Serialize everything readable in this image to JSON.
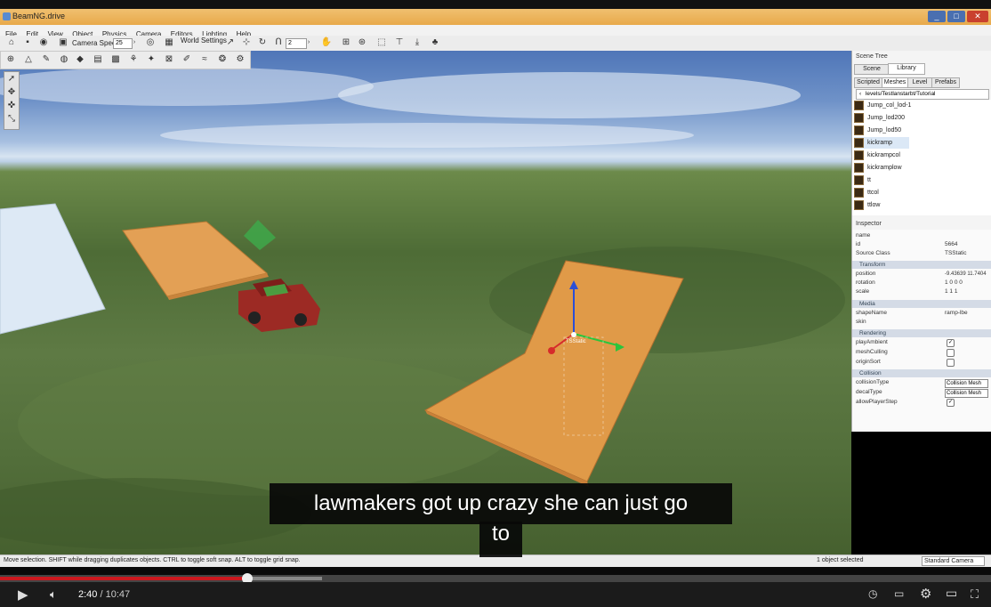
{
  "window": {
    "title": "BeamNG.drive"
  },
  "menu": [
    "File",
    "Edit",
    "View",
    "Object",
    "Physics",
    "Camera",
    "Editors",
    "Lighting",
    "Help"
  ],
  "toolbar": {
    "camera_speed_label": "Camera Speed",
    "camera_speed_value": "25",
    "world_settings_label": "World Settings",
    "grid_value": "2"
  },
  "scene_tree": {
    "header": "Scene Tree",
    "tabs": [
      "Scene",
      "Library"
    ],
    "active_tab": "Library",
    "subtabs": [
      "Scripted",
      "Meshes",
      "Level",
      "Prefabs"
    ],
    "active_subtab": "Meshes",
    "path": "levels/Testlanstarbt/Tutorial",
    "items": [
      "Jump_col_lod-1",
      "Jump_lod200",
      "Jump_lod50",
      "kickramp",
      "kickrampcol",
      "kickramplow",
      "tt",
      "ttcol",
      "ttlow"
    ],
    "selected_item": "kickramp"
  },
  "inspector": {
    "header": "Inspector",
    "rows": [
      {
        "label": "name",
        "value": ""
      },
      {
        "label": "id",
        "value": "5664"
      },
      {
        "label": "Source Class",
        "value": "TSStatic"
      }
    ],
    "transform": {
      "title": "Transform",
      "rows": [
        {
          "label": "position",
          "value": "-9.43639 11.7404"
        },
        {
          "label": "rotation",
          "value": "1 0 0 0"
        },
        {
          "label": "scale",
          "value": "1 1 1"
        }
      ]
    },
    "media": {
      "title": "Media",
      "rows": [
        {
          "label": "shapeName",
          "value": "ramp-lbe"
        },
        {
          "label": "skin",
          "value": ""
        }
      ]
    },
    "rendering": {
      "title": "Rendering",
      "rows": [
        {
          "label": "playAmbient",
          "checked": true
        },
        {
          "label": "meshCulling",
          "checked": false
        },
        {
          "label": "originSort",
          "checked": false
        }
      ]
    },
    "collision": {
      "title": "Collision",
      "rows": [
        {
          "label": "collisionType",
          "value": "Collision Mesh"
        },
        {
          "label": "decalType",
          "value": "Collision Mesh"
        },
        {
          "label": "allowPlayerStep",
          "checked": true
        }
      ]
    }
  },
  "viewport": {
    "object_label": "TSStatic"
  },
  "status": {
    "hint": "Move selection.  SHIFT while dragging duplicates objects.  CTRL to toggle soft snap.  ALT to toggle grid snap.",
    "selection": "1 object selected",
    "camera": "Standard Camera"
  },
  "subtitle": {
    "line1": "lawmakers got up crazy she can just go",
    "line2": "to"
  },
  "player": {
    "current_time": "2:40",
    "separator": "/",
    "duration": "10:47",
    "progress": 0.25
  },
  "colors": {
    "accent_red": "#cc181e",
    "ramp_orange": "#e09a48"
  }
}
